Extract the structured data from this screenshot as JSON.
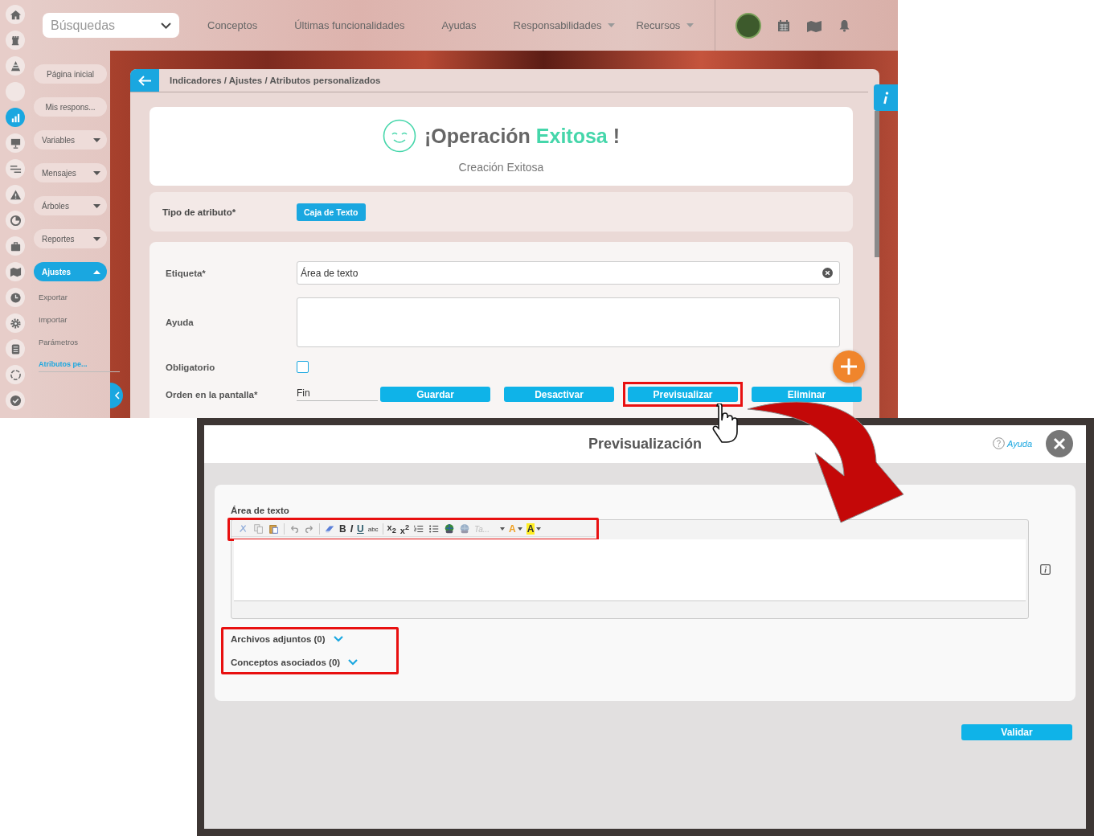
{
  "app_screen": {
    "rail": [
      {
        "kind": "home",
        "selected": false
      },
      {
        "kind": "rook",
        "selected": false
      },
      {
        "kind": "pyramid",
        "selected": false
      },
      {
        "kind": "blank",
        "selected": false
      },
      {
        "kind": "bar-chart",
        "selected": true
      },
      {
        "kind": "presentation",
        "selected": false
      },
      {
        "kind": "sliders",
        "selected": false
      },
      {
        "kind": "warning",
        "selected": false
      },
      {
        "kind": "pie-chart",
        "selected": false
      },
      {
        "kind": "briefcase",
        "selected": false
      },
      {
        "kind": "map",
        "selected": false
      },
      {
        "kind": "clock",
        "selected": false
      },
      {
        "kind": "gear",
        "selected": false
      },
      {
        "kind": "list",
        "selected": false
      },
      {
        "kind": "cycle",
        "selected": false
      },
      {
        "kind": "check",
        "selected": false
      }
    ],
    "search": {
      "placeholder": "Búsquedas"
    },
    "nav": [
      {
        "label": "Conceptos",
        "has_menu": false
      },
      {
        "label": "Últimas funcionalidades",
        "has_menu": false
      },
      {
        "label": "Ayudas",
        "has_menu": false
      },
      {
        "label": "Responsabilidades",
        "has_menu": true
      },
      {
        "label": "Recursos",
        "has_menu": true
      }
    ],
    "side_menu": [
      {
        "label": "Página inicial",
        "kind": "link"
      },
      {
        "label": "Mis respons...",
        "kind": "link"
      },
      {
        "label": "Variables",
        "kind": "group",
        "expanded": false
      },
      {
        "label": "Mensajes",
        "kind": "group",
        "expanded": false
      },
      {
        "label": "Árboles",
        "kind": "group",
        "expanded": false
      },
      {
        "label": "Reportes",
        "kind": "group",
        "expanded": false
      },
      {
        "label": "Ajustes",
        "kind": "group",
        "expanded": true,
        "children": [
          {
            "label": "Exportar",
            "selected": false
          },
          {
            "label": "Importar",
            "selected": false
          },
          {
            "label": "Parámetros",
            "selected": false
          },
          {
            "label": "Atributos pe...",
            "selected": true
          }
        ]
      }
    ],
    "breadcrumb": "Indicadores / Ajustes / Atributos personalizados",
    "message": {
      "title_start": "¡Operación",
      "title_highlight": "Exitosa",
      "title_end": "!",
      "subtitle": "Creación Exitosa"
    },
    "attribute_type": {
      "label": "Tipo de atributo*",
      "value": "Caja de Texto"
    },
    "fields": [
      {
        "kind": "text",
        "label": "Etiqueta*",
        "value": "Área de texto"
      },
      {
        "kind": "textarea",
        "label": "Ayuda"
      },
      {
        "kind": "checkbox",
        "label": "Obligatorio",
        "checked": false
      },
      {
        "kind": "select",
        "label": "Orden en la pantalla*",
        "value": "Fin"
      }
    ],
    "actions": [
      {
        "label": "Guardar",
        "highlighted": false
      },
      {
        "label": "Desactivar",
        "highlighted": false
      },
      {
        "label": "Previsualizar",
        "highlighted": true
      },
      {
        "label": "Eliminar",
        "highlighted": false
      }
    ]
  },
  "preview_dialog": {
    "title": "Previsualización",
    "help": "Ayuda",
    "editor": {
      "label": "Área de texto",
      "toolbar_highlighted": true,
      "toolbar": [
        {
          "kind": "cut"
        },
        {
          "kind": "copy"
        },
        {
          "kind": "paste"
        },
        {
          "kind": "separator"
        },
        {
          "kind": "undo"
        },
        {
          "kind": "redo"
        },
        {
          "kind": "separator"
        },
        {
          "kind": "eraser"
        },
        {
          "kind": "bold",
          "glyph": "B"
        },
        {
          "kind": "italic",
          "glyph": "I"
        },
        {
          "kind": "underline",
          "glyph": "U"
        },
        {
          "kind": "strike",
          "glyph": "abc"
        },
        {
          "kind": "separator"
        },
        {
          "kind": "subscript",
          "glyph": "x$_{2}$"
        },
        {
          "kind": "superscript",
          "glyph": "x$^{2}$"
        },
        {
          "kind": "ordered-list"
        },
        {
          "kind": "bullet-list"
        },
        {
          "kind": "link"
        },
        {
          "kind": "unlink"
        },
        {
          "kind": "font",
          "glyph": "Ta..."
        },
        {
          "kind": "font-color",
          "glyph": "A"
        },
        {
          "kind": "highlight",
          "glyph": "A"
        }
      ]
    },
    "sections_highlighted": true,
    "sections": [
      {
        "label": "Archivos adjuntos (0)",
        "expanded": false
      },
      {
        "label": "Conceptos asociados (0)",
        "expanded": false
      }
    ],
    "validate": "Validar"
  }
}
